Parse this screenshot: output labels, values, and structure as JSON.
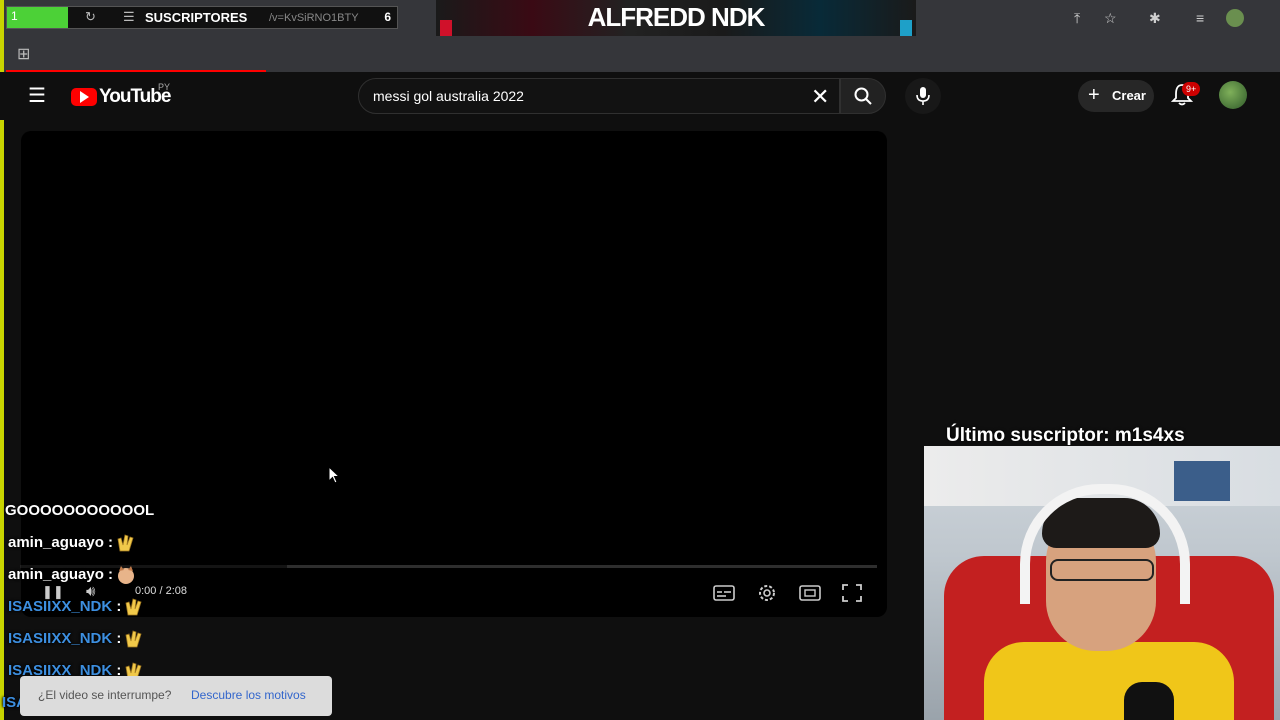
{
  "browser": {
    "overlay_subs_label": "SUSCRIPTORES",
    "overlay_subs_count": "6",
    "overlay_progress": "1",
    "url_fragment": "/v=KvSiRNO1BTY",
    "stream_title": "ALFREDD NDK"
  },
  "youtube": {
    "logo_text": "YouTube",
    "country_code": "PY",
    "search_value": "messi gol australia 2022",
    "create_label": "Crear",
    "notifications_badge": "9+"
  },
  "player": {
    "time": "0:00 / 2:08",
    "progress_fraction": 0.0
  },
  "chat": {
    "goal_message": "GOOOOOOOOOOOL",
    "messages": [
      {
        "user": "amin_aguayo",
        "sep": " :",
        "emote": "clap-emote"
      },
      {
        "user": "amin_aguayo",
        "sep": " :",
        "emote": "cat-emote"
      },
      {
        "user": "ISASIIXX_NDK",
        "sep": " :",
        "emote": "clap-emote"
      },
      {
        "user": "ISASIIXX_NDK",
        "sep": " :",
        "emote": "clap-emote"
      },
      {
        "user": "ISASIIXX_NDK",
        "sep": " :",
        "emote": "clap-emote"
      },
      {
        "user": "ISASIIXX_NDK",
        "sep": " :",
        "emote": "clap-emote"
      }
    ]
  },
  "toast": {
    "text": "¿El video se interrumpe?",
    "link": "Descubre los motivos"
  },
  "stream": {
    "last_subscriber": "Último suscriptor: m1s4xs"
  },
  "colors": {
    "yt_red": "#ff0000",
    "chat_blue": "#3d8fe0",
    "overlay_green": "#4cd137"
  }
}
